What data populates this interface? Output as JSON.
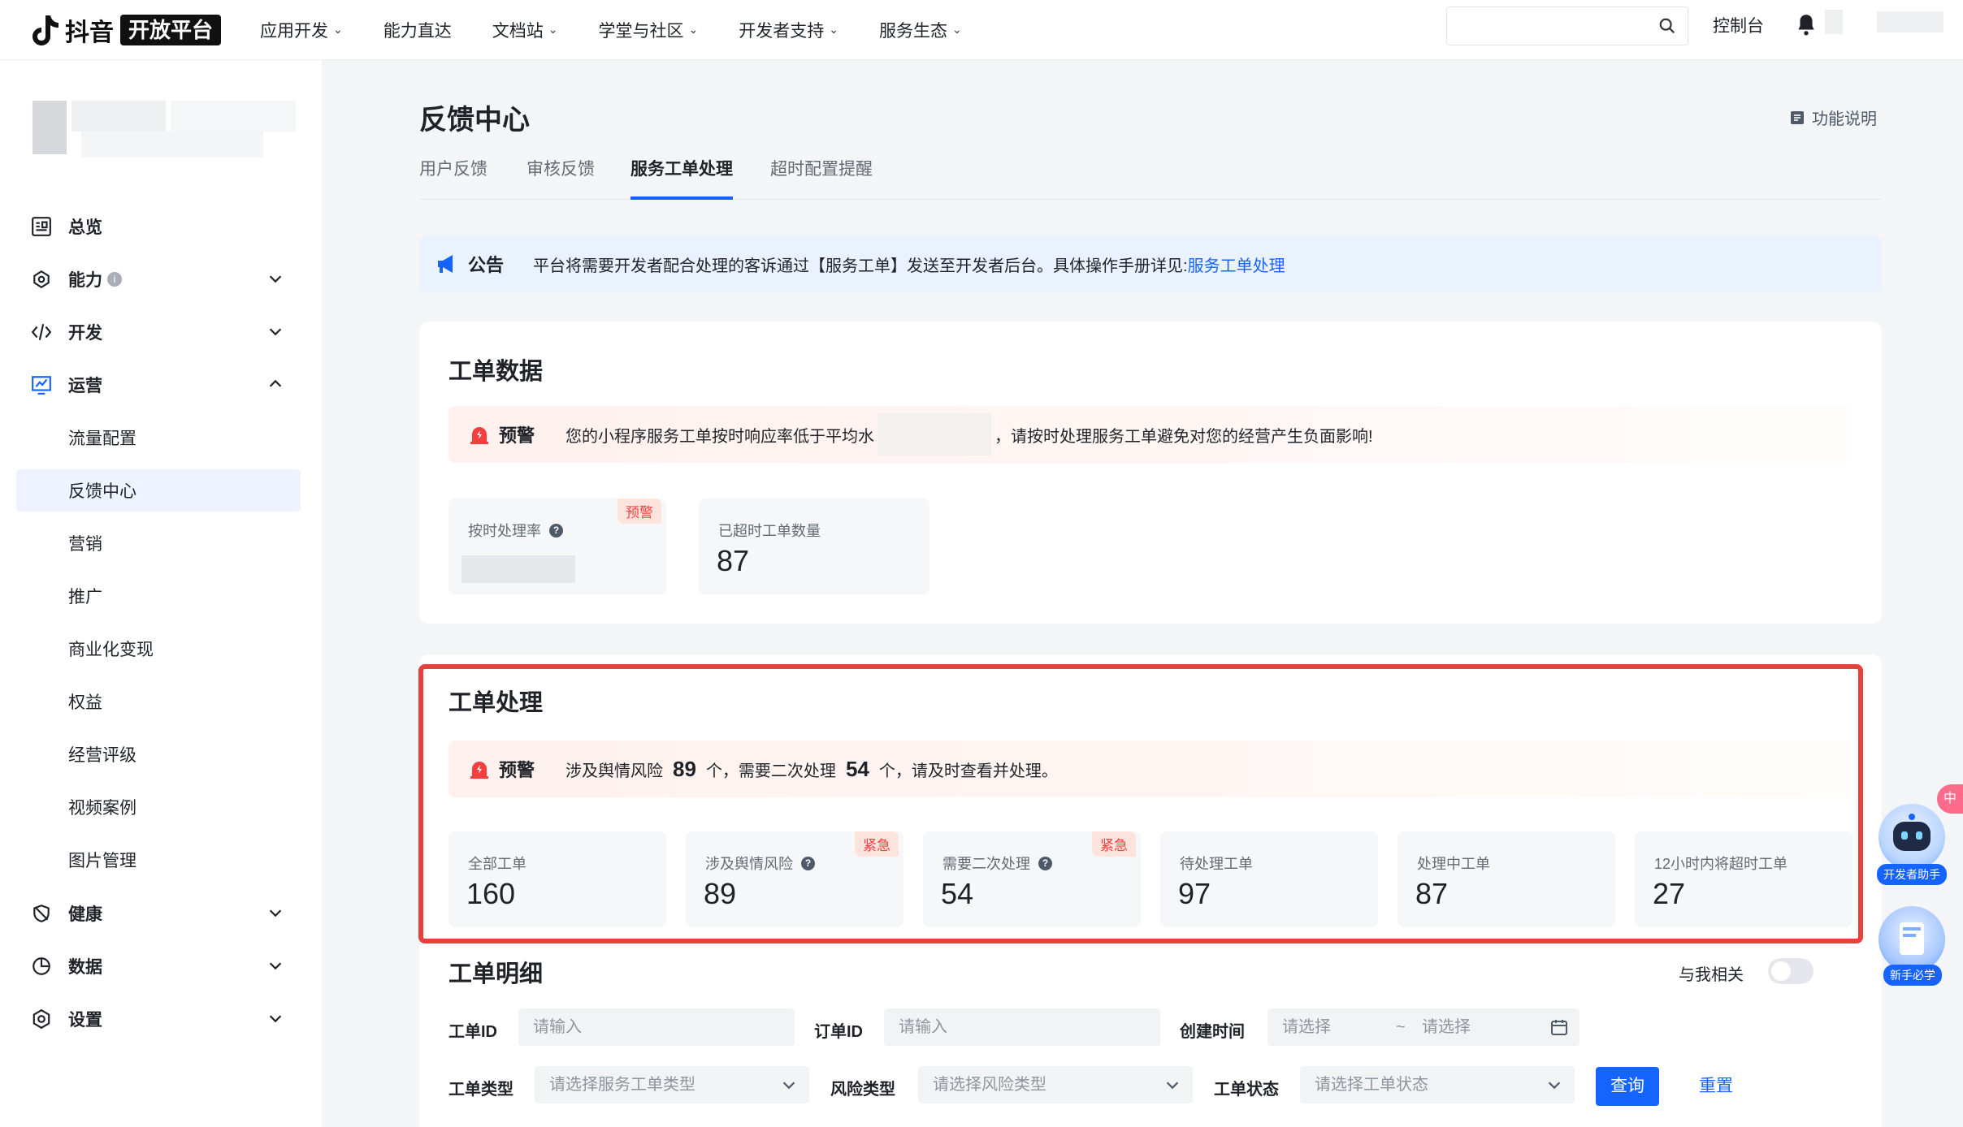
{
  "topnav": {
    "logo_text": "抖音",
    "logo_badge": "开放平台",
    "menu": [
      {
        "label": "应用开发",
        "has_dropdown": true
      },
      {
        "label": "能力直达",
        "has_dropdown": false
      },
      {
        "label": "文档站",
        "has_dropdown": true
      },
      {
        "label": "学堂与社区",
        "has_dropdown": true
      },
      {
        "label": "开发者支持",
        "has_dropdown": true
      },
      {
        "label": "服务生态",
        "has_dropdown": true
      }
    ],
    "search_placeholder": "",
    "console_label": "控制台"
  },
  "sidebar": {
    "items": [
      {
        "label": "总览",
        "icon": "overview-icon"
      },
      {
        "label": "能力",
        "icon": "ability-icon",
        "info": "i"
      },
      {
        "label": "开发",
        "icon": "code-icon"
      },
      {
        "label": "运营",
        "icon": "chart-icon"
      },
      {
        "label": "健康",
        "icon": "health-icon"
      },
      {
        "label": "数据",
        "icon": "pie-icon"
      },
      {
        "label": "设置",
        "icon": "settings-icon"
      }
    ],
    "sub_items": [
      "流量配置",
      "反馈中心",
      "营销",
      "推广",
      "商业化变现",
      "权益",
      "经营评级",
      "视频案例",
      "图片管理"
    ],
    "active_sub": "反馈中心"
  },
  "main": {
    "title": "反馈中心",
    "func_doc": "功能说明",
    "tabs": [
      "用户反馈",
      "审核反馈",
      "服务工单处理",
      "超时配置提醒"
    ],
    "active_tab": "服务工单处理",
    "notice": {
      "label": "公告",
      "text": "平台将需要开发者配合处理的客诉通过【服务工单】发送至开发者后台。具体操作手册详见:",
      "link": "服务工单处理"
    },
    "ticket_data": {
      "title": "工单数据",
      "warn_label": "预警",
      "warn_text_a": "您的小程序服务工单按时响应率低于平均水",
      "warn_text_b": "，请按时处理服务工单避免对您的经营产生负面影响!",
      "stats": [
        {
          "label": "按时处理率",
          "value": "",
          "tag": "预警",
          "help": true
        },
        {
          "label": "已超时工单数量",
          "value": "87"
        }
      ]
    },
    "ticket_process": {
      "title": "工单处理",
      "warn_label": "预警",
      "warn_a": "涉及舆情风险",
      "risk_count": "89",
      "warn_b": "个，需要二次处理",
      "second_count": "54",
      "warn_c": "个，请及时查看并处理。",
      "stats": [
        {
          "label": "全部工单",
          "value": "160"
        },
        {
          "label": "涉及舆情风险",
          "value": "89",
          "tag": "紧急",
          "help": true
        },
        {
          "label": "需要二次处理",
          "value": "54",
          "tag": "紧急",
          "help": true
        },
        {
          "label": "待处理工单",
          "value": "97"
        },
        {
          "label": "处理中工单",
          "value": "87"
        },
        {
          "label": "12小时内将超时工单",
          "value": "27"
        }
      ]
    },
    "ticket_detail": {
      "title": "工单明细",
      "related_label": "与我相关",
      "related_on": false,
      "filters": {
        "ticket_id_label": "工单ID",
        "ticket_id_placeholder": "请输入",
        "order_id_label": "订单ID",
        "order_id_placeholder": "请输入",
        "created_label": "创建时间",
        "date_start": "请选择",
        "date_sep": "~",
        "date_end": "请选择",
        "type_label": "工单类型",
        "type_placeholder": "请选择服务工单类型",
        "risk_label": "风险类型",
        "risk_placeholder": "请选择风险类型",
        "status_label": "工单状态",
        "status_placeholder": "请选择工单状态"
      },
      "query_button": "查询",
      "reset_button": "重置"
    }
  },
  "floating": {
    "assistant_label": "开发者助手",
    "guide_label": "新手必学",
    "lang_badge": "中",
    "primary_color": "#1664ff",
    "warn_color": "#f53f3f"
  }
}
